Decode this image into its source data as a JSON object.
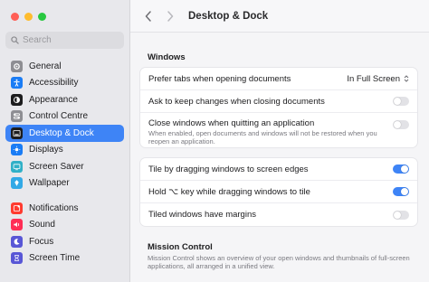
{
  "window": {
    "traffic_lights": {
      "close": "#ff5f57",
      "minimize": "#febc2e",
      "zoom": "#28c840"
    }
  },
  "sidebar": {
    "search": {
      "placeholder": "Search"
    },
    "groups": [
      [
        {
          "label": "General",
          "icon": "gear-icon",
          "color": "#8e8e93"
        },
        {
          "label": "Accessibility",
          "icon": "accessibility-icon",
          "color": "#1a7cf5"
        },
        {
          "label": "Appearance",
          "icon": "appearance-icon",
          "color": "#1c1c1e"
        },
        {
          "label": "Control Centre",
          "icon": "control-centre-icon",
          "color": "#8e8e93"
        },
        {
          "label": "Desktop & Dock",
          "icon": "dock-icon",
          "color": "#1c1c1e",
          "selected": true
        },
        {
          "label": "Displays",
          "icon": "displays-icon",
          "color": "#1a7cf5"
        },
        {
          "label": "Screen Saver",
          "icon": "screen-saver-icon",
          "color": "#30b0c7"
        },
        {
          "label": "Wallpaper",
          "icon": "wallpaper-icon",
          "color": "#32a9e6"
        }
      ],
      [
        {
          "label": "Notifications",
          "icon": "notifications-icon",
          "color": "#ff3b30"
        },
        {
          "label": "Sound",
          "icon": "sound-icon",
          "color": "#ff2d55"
        },
        {
          "label": "Focus",
          "icon": "focus-icon",
          "color": "#5856d6"
        },
        {
          "label": "Screen Time",
          "icon": "screen-time-icon",
          "color": "#5856d6"
        }
      ]
    ]
  },
  "main": {
    "title": "Desktop & Dock",
    "windows_section": {
      "title": "Windows",
      "rows": [
        {
          "label": "Prefer tabs when opening documents",
          "control": "select",
          "value": "In Full Screen"
        },
        {
          "label": "Ask to keep changes when closing documents",
          "control": "toggle",
          "on": false
        },
        {
          "label": "Close windows when quitting an application",
          "sublabel": "When enabled, open documents and windows will not be restored when you reopen an application.",
          "control": "toggle",
          "on": false
        }
      ]
    },
    "tiling_section": {
      "rows": [
        {
          "label": "Tile by dragging windows to screen edges",
          "control": "toggle",
          "on": true
        },
        {
          "label": "Hold ⌥ key while dragging windows to tile",
          "control": "toggle",
          "on": true
        },
        {
          "label": "Tiled windows have margins",
          "control": "toggle",
          "on": false
        }
      ]
    },
    "mission_control": {
      "title": "Mission Control",
      "description": "Mission Control shows an overview of your open windows and thumbnails of full-screen applications, all arranged in a unified view."
    }
  }
}
